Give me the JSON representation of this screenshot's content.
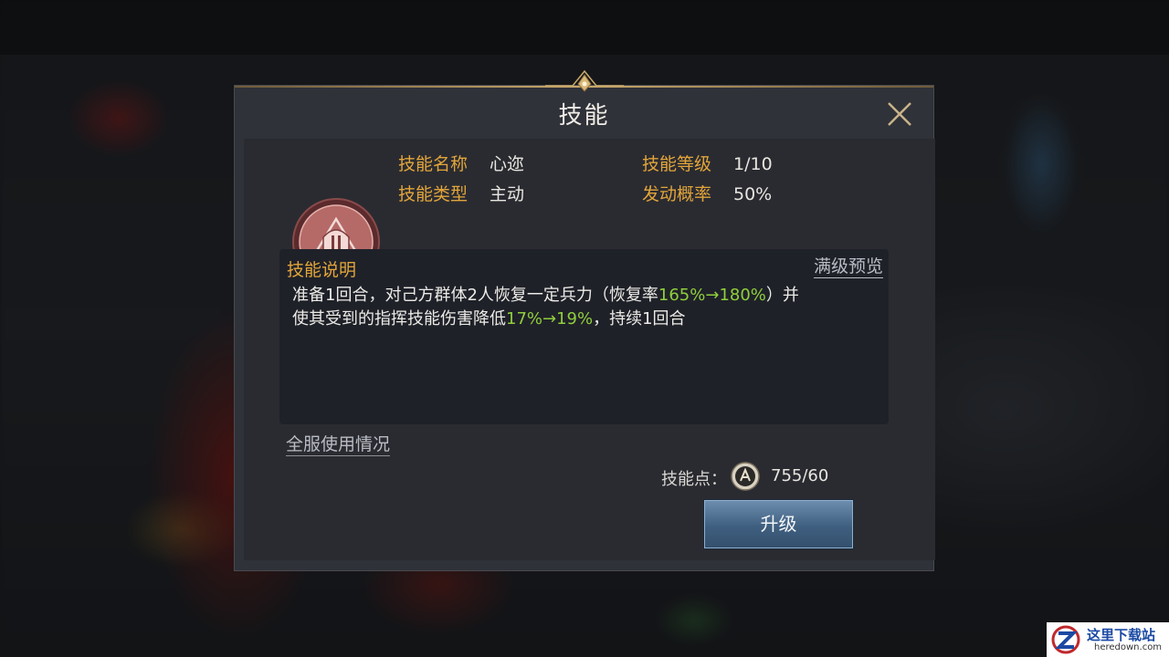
{
  "dialog": {
    "title": "技能",
    "close_icon": "close-icon"
  },
  "skill": {
    "icon": "helmet-sword-emblem-icon",
    "name_label": "技能名称",
    "name_value": "心迩",
    "level_label": "技能等级",
    "level_value": "1/10",
    "type_label": "技能类型",
    "type_value": "主动",
    "chance_label": "发动概率",
    "chance_value": "50%"
  },
  "description": {
    "title": "技能说明",
    "preview_link": "满级预览",
    "line1_a": "准备1回合，对己方群体2人恢复一定兵力（恢复率",
    "line1_highlight": "165%→180%",
    "line1_b": "）并",
    "line2_a": "使其受到的指挥技能伤害降低",
    "line2_highlight": "17%→19%",
    "line2_b": "，持续1回合"
  },
  "footer": {
    "usage_link": "全服使用情况",
    "points_label": "技能点：",
    "points_icon": "skill-point-coin-icon",
    "points_value": "755/60",
    "upgrade_button": "升级"
  },
  "watermark": {
    "text_cn": "这里下载站",
    "text_en": "heredown.com"
  },
  "colors": {
    "label_gold": "#e2a53a",
    "highlight_green": "#8fcf3c",
    "button_blue": "#3f5f80"
  }
}
